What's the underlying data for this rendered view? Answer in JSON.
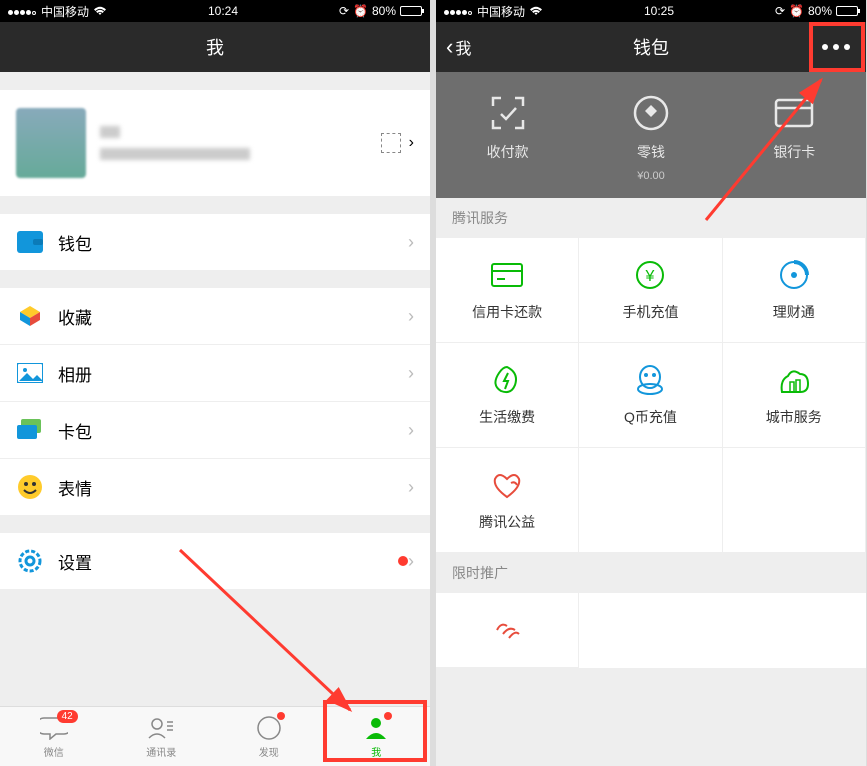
{
  "left": {
    "status": {
      "carrier": "中国移动",
      "time": "10:24",
      "battery": "80%"
    },
    "nav": {
      "title": "我"
    },
    "rows": {
      "wallet": "钱包",
      "favorites": "收藏",
      "album": "相册",
      "cards": "卡包",
      "emoji": "表情",
      "settings": "设置"
    },
    "tabs": {
      "chat": "微信",
      "chat_badge": "42",
      "contacts": "通讯录",
      "discover": "发现",
      "me": "我"
    }
  },
  "right": {
    "status": {
      "carrier": "中国移动",
      "time": "10:25",
      "battery": "80%"
    },
    "nav": {
      "back": "我",
      "title": "钱包"
    },
    "head": {
      "pay": "收付款",
      "balance": "零钱",
      "balance_sub": "¥0.00",
      "card": "银行卡"
    },
    "section1": "腾讯服务",
    "grid": {
      "credit": "信用卡还款",
      "topup": "手机充值",
      "licai": "理财通",
      "bills": "生活缴费",
      "qcoin": "Q币充值",
      "city": "城市服务",
      "charity": "腾讯公益"
    },
    "section2": "限时推广"
  }
}
